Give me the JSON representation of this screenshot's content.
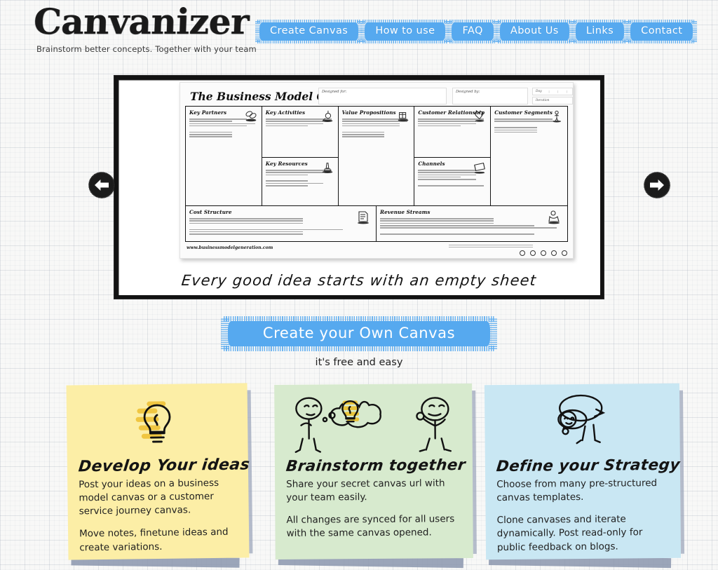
{
  "site": {
    "logo": "Canvanizer",
    "tagline": "Brainstorm better concepts. Together with your team"
  },
  "nav": {
    "items": [
      {
        "label": "Create Canvas",
        "name": "nav-create-canvas"
      },
      {
        "label": "How to use",
        "name": "nav-how-to-use"
      },
      {
        "label": "FAQ",
        "name": "nav-faq"
      },
      {
        "label": "About Us",
        "name": "nav-about-us"
      },
      {
        "label": "Links",
        "name": "nav-links"
      },
      {
        "label": "Contact",
        "name": "nav-contact"
      }
    ],
    "accent_color": "#56a9ef"
  },
  "slider": {
    "prev_icon": "arrow-left-icon",
    "next_icon": "arrow-right-icon",
    "slogan": "Every good idea starts with an empty sheet",
    "canvas": {
      "title": "The Business Model Canvas",
      "meta": {
        "designed_for": "Designed for:",
        "designed_by": "Designed by:",
        "day": "Day",
        "iteration": "Iteration"
      },
      "blocks": [
        {
          "title": "Key Partners",
          "icon": "chain-links-icon"
        },
        {
          "title": "Key Activities",
          "icon": "gears-flag-icon"
        },
        {
          "title": "Value Propositions",
          "icon": "gift-box-icon"
        },
        {
          "title": "Customer Relationship",
          "icon": "heart-icon"
        },
        {
          "title": "Customer Segments",
          "icon": "people-icon"
        },
        {
          "title": "Key Resources",
          "icon": "lighthouse-icon"
        },
        {
          "title": "Channels",
          "icon": "truck-icon"
        },
        {
          "title": "Cost Structure",
          "icon": "price-tag-icon"
        },
        {
          "title": "Revenue Streams",
          "icon": "coin-hand-icon"
        }
      ],
      "footer_url": "www.businessmodelgeneration.com",
      "license_icons": [
        "cc-icon",
        "by-icon",
        "sa-icon",
        "nd-icon",
        "info-icon"
      ]
    }
  },
  "cta": {
    "button_label": "Create your Own Canvas",
    "subtext": "it's free and easy"
  },
  "notes": [
    {
      "name": "note-develop-your-ideas",
      "title": "Develop Your ideas",
      "icon": "lightbulb-icon",
      "color": "#fceea6",
      "paragraphs": [
        "Post your ideas on a business model canvas or a customer service journey canvas.",
        "Move notes, finetune ideas and create variations."
      ]
    },
    {
      "name": "note-brainstorm-together",
      "title": "Brainstorm together",
      "icon": "two-people-thought-bubble-icon",
      "color": "#d7eace",
      "paragraphs": [
        "Share your secret canvas url with your team easily.",
        "All changes are synced for all users with the same canvas opened."
      ]
    },
    {
      "name": "note-define-your-strategy",
      "title": "Define your Strategy",
      "icon": "person-magnifying-glass-icon",
      "color": "#c9e7f3",
      "paragraphs": [
        "Choose from many pre-structured canvas templates.",
        "Clone canvases and iterate dynamically. Post read-only for public feedback on blogs."
      ]
    }
  ]
}
